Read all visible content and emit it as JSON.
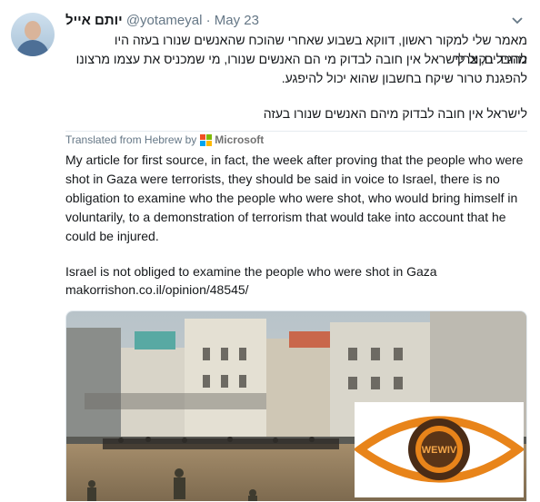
{
  "tweet": {
    "display_name": "יותם אייל",
    "handle": "@yotameyal",
    "separator": "·",
    "date": "May 23",
    "hebrew_lines": [
      "מאמר שלי למקור ראשון, דווקא בשבוע שאחרי שהוכח שהאנשים שנורו בעזה היו מחבלים, צריך",
      "להגיד בקול לישראל אין חובה לבדוק מי הם האנשים שנורו, מי שמכניס את עצמו מרצונו",
      "להפגנת טרור שיקח בחשבון שהוא יכול להיפגע.",
      "לישראל אין חובה לבדוק מיהם האנשים שנורו בעזה"
    ],
    "translated_by": "Translated from Hebrew by",
    "translator": "Microsoft",
    "translation_paragraph": "My article for first source, in fact, the week after proving that the people who were shot in Gaza were terrorists, they should be said in voice to Israel, there is no obligation to examine who the people who were shot, who would bring himself in voluntarily, to a demonstration of terrorism that would take into account that he could be injured.",
    "translation_link_title": "Israel is not obliged to examine the people who were shot in Gaza",
    "link_url": "makorrishon.co.il/opinion/48545/"
  },
  "watermark_text": "WEWIV",
  "icons": {
    "avatar": "user-avatar",
    "caret": "chevron-down-icon",
    "translator_logo": "microsoft-logo-icon",
    "watermark": "eye-logo-watermark"
  },
  "colors": {
    "text": "#14171a",
    "muted": "#657786",
    "link": "#1da1f2",
    "ms_red": "#f25022",
    "ms_green": "#7fba00",
    "ms_blue": "#00a4ef",
    "ms_yellow": "#ffb900",
    "watermark_orange": "#e8841a"
  }
}
